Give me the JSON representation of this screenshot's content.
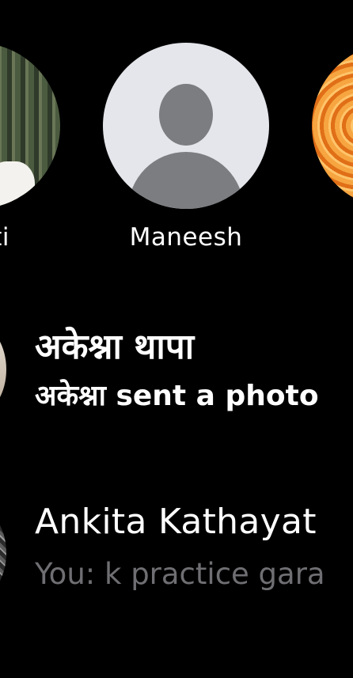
{
  "stories": [
    {
      "name": "ti",
      "avatar": "forest-photo"
    },
    {
      "name": "Maneesh",
      "avatar": "default-avatar"
    },
    {
      "name": "",
      "avatar": "pattern-photo"
    }
  ],
  "conversations": [
    {
      "title": "अकेश्ना थापा",
      "preview": "अकेश्ना sent a photo",
      "unread": true
    },
    {
      "title": "Ankita Kathayat",
      "preview": "You: k practice gara",
      "unread": false
    }
  ],
  "colors": {
    "background": "#000000",
    "text_primary": "#ffffff",
    "text_secondary": "#6f6f73",
    "default_avatar_bg": "#e4e6eb",
    "default_avatar_fg": "#7b7d80"
  }
}
